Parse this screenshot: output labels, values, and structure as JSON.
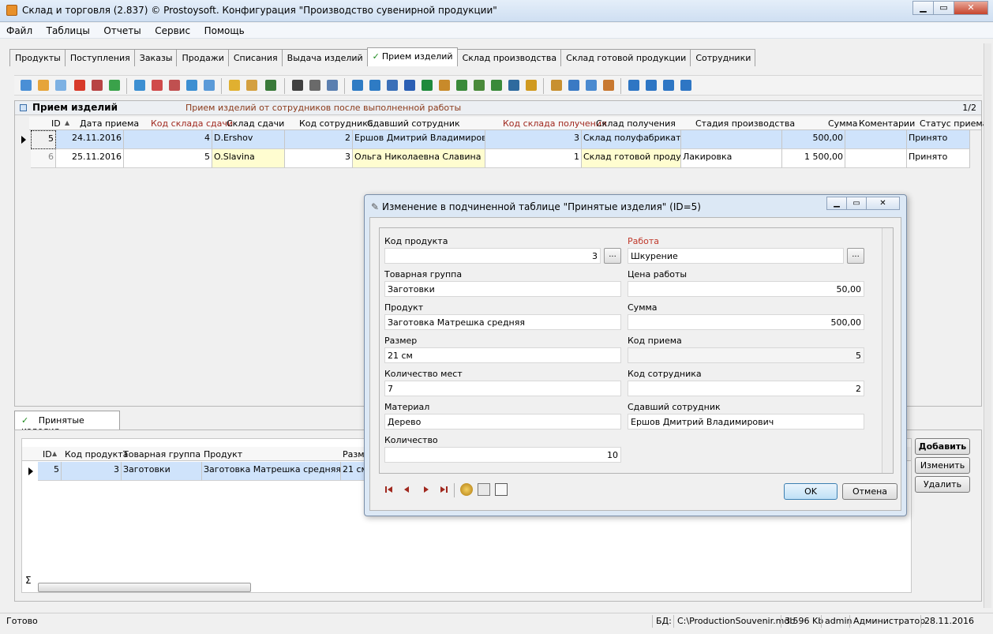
{
  "window": {
    "title": "Склад и торговля (2.837) © Prostoysoft. Конфигурация \"Производство сувенирной продукции\"",
    "min": "▁",
    "max": "▭",
    "close": "✕"
  },
  "menu": [
    "Файл",
    "Таблицы",
    "Отчеты",
    "Сервис",
    "Помощь"
  ],
  "tabs": [
    {
      "label": "Продукты"
    },
    {
      "label": "Поступления"
    },
    {
      "label": "Заказы"
    },
    {
      "label": "Продажи"
    },
    {
      "label": "Списания"
    },
    {
      "label": "Выдача изделий"
    },
    {
      "label": "Прием изделий",
      "active": true
    },
    {
      "label": "Склад производства"
    },
    {
      "label": "Склад готовой продукции"
    },
    {
      "label": "Сотрудники"
    }
  ],
  "panel": {
    "title": "Прием изделий",
    "subtitle": "Прием изделий от сотрудников после выполненной работы",
    "pager": "1/2"
  },
  "main_grid": {
    "columns": [
      "ID",
      "Дата приема",
      "Код склада сдачи",
      "Склад сдачи",
      "Код сотрудника",
      "Сдавший сотрудник",
      "Код склада получения",
      "Склад получения",
      "Стадия производства",
      "Сумма",
      "Коментарии",
      "Статус приема"
    ],
    "rows": [
      [
        "5",
        "24.11.2016",
        "4",
        "D.Ershov",
        "2",
        "Ершов Дмитрий Владимирович",
        "3",
        "Склад полуфабрикатов",
        "",
        "500,00",
        "",
        "Принято"
      ],
      [
        "6",
        "25.11.2016",
        "5",
        "O.Slavina",
        "3",
        "Ольга Николаевна Славина",
        "1",
        "Склад готовой продукц",
        "Лакировка",
        "1 500,00",
        "",
        "Принято"
      ]
    ]
  },
  "sub": {
    "tab_label": "Принятые изделия",
    "columns": [
      "ID",
      "Код продукта",
      "Товарная группа",
      "Продукт",
      "Разме"
    ],
    "rows": [
      [
        "5",
        "3",
        "Заготовки",
        "Заготовка Матрешка средняя",
        "21 см"
      ]
    ],
    "sum_symbol": "Σ",
    "buttons": {
      "add": "Добавить",
      "edit": "Изменить",
      "delete": "Удалить"
    }
  },
  "dialog": {
    "title": "Изменение в подчиненной таблице \"Принятые изделия\" (ID=5)",
    "fields": {
      "product_code": {
        "label": "Код продукта",
        "value": "3"
      },
      "group": {
        "label": "Товарная группа",
        "value": "Заготовки"
      },
      "product": {
        "label": "Продукт",
        "value": "Заготовка Матрешка средняя"
      },
      "size": {
        "label": "Размер",
        "value": "21 см"
      },
      "places": {
        "label": "Количество мест",
        "value": "7"
      },
      "material": {
        "label": "Материал",
        "value": "Дерево"
      },
      "quantity": {
        "label": "Количество",
        "value": "10"
      },
      "work": {
        "label": "Работа",
        "value": "Шкурение"
      },
      "work_price": {
        "label": "Цена работы",
        "value": "50,00"
      },
      "sum": {
        "label": "Сумма",
        "value": "500,00"
      },
      "receipt_code": {
        "label": "Код приема",
        "value": "5"
      },
      "employee_code": {
        "label": "Код сотрудника",
        "value": "2"
      },
      "employee": {
        "label": "Сдавший сотрудник",
        "value": "Ершов Дмитрий Владимирович"
      }
    },
    "ellipsis": "...",
    "ok": "OK",
    "cancel": "Отмена"
  },
  "status": {
    "ready": "Готово",
    "db_label": "БД:",
    "db_file": "C:\\ProductionSouvenir.mdb",
    "size": "3 596 Kb",
    "user": "admin",
    "role": "Администратор",
    "date": "28.11.2016"
  },
  "colors": {
    "selection": "#cfe3fb",
    "readonly_yellow": "#fffdd0",
    "required_red": "#c0392b",
    "brown_subtitle": "#8b3a1a"
  }
}
